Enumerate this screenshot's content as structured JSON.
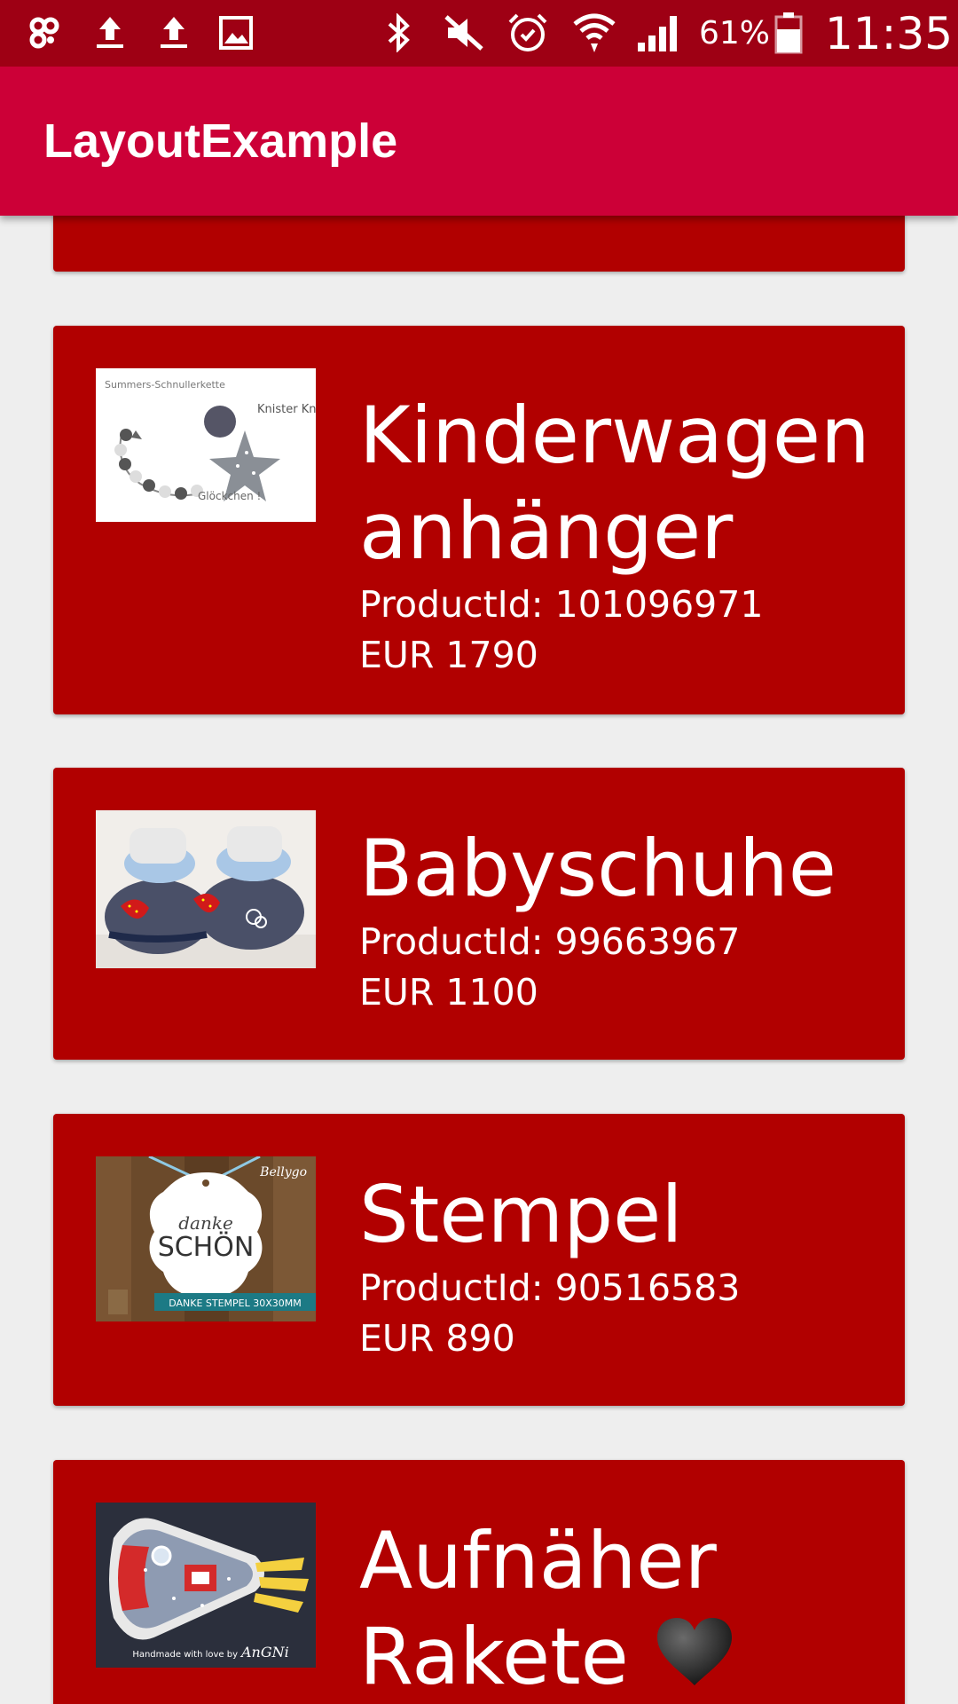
{
  "status_bar": {
    "icons": [
      "notification-icon",
      "upload-icon",
      "upload-icon",
      "image-icon",
      "bluetooth-icon",
      "vibrate-icon",
      "alarm-icon",
      "wifi-icon",
      "signal-icon",
      "battery-icon"
    ],
    "battery_percent": "61%",
    "time": "11:35"
  },
  "app_bar": {
    "title": "LayoutExample"
  },
  "products": [
    {
      "name_line1": "Kinderwagen",
      "name_line2": "anhänger",
      "product_id": "ProductId: 101096971",
      "price": "EUR 1790",
      "thumb": {
        "caption_left": "Summers-Schnullerkette",
        "caption_right": "Knister Knister !!",
        "caption_bottom": "Glöckchen !"
      }
    },
    {
      "name_line1": "Babyschuhe",
      "product_id": "ProductId: 99663967",
      "price": "EUR 1100"
    },
    {
      "name_line1": "Stempel",
      "product_id": "ProductId: 90516583",
      "price": "EUR 890",
      "thumb": {
        "script_text": "danke",
        "main_text": "SCHÖN",
        "brand": "Bellygo",
        "banner": "DANKE STEMPEL 30X30MM"
      }
    },
    {
      "name_line1": "Aufnäher",
      "name_line2": "Rakete",
      "thumb": {
        "caption": "Handmade with love by",
        "brand": "AnGNi"
      }
    }
  ],
  "colors": {
    "status_bar": "#9e0014",
    "app_bar": "#cc0037",
    "card": "#b10000",
    "background": "#eeeeee",
    "text": "#ffffff"
  }
}
